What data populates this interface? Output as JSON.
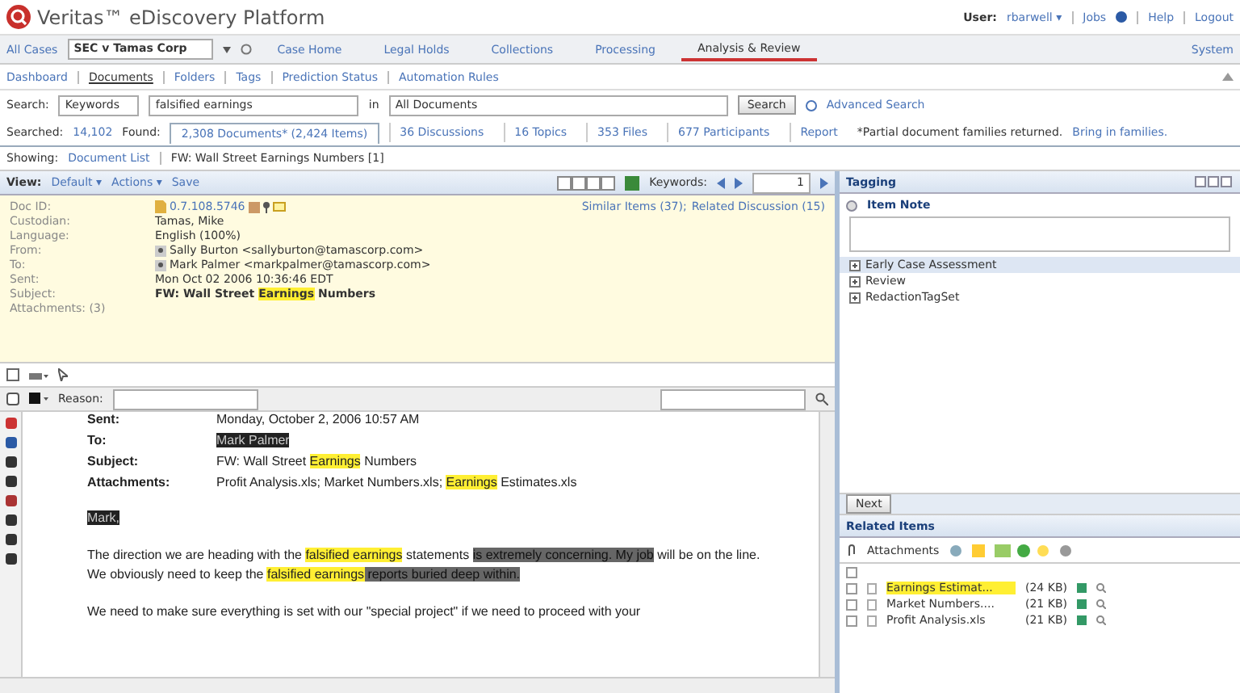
{
  "header": {
    "product": "Veritas™ eDiscovery Platform",
    "user_label": "User:",
    "user": "rbarwell ▾",
    "jobs": "Jobs",
    "help": "Help",
    "logout": "Logout"
  },
  "nav": {
    "all_cases": "All Cases",
    "case": "SEC v Tamas Corp",
    "tabs": [
      {
        "label": "Case Home",
        "selected": false
      },
      {
        "label": "Legal Holds",
        "selected": false
      },
      {
        "label": "Collections",
        "selected": false
      },
      {
        "label": "Processing",
        "selected": false
      },
      {
        "label": "Analysis & Review",
        "selected": true
      }
    ],
    "system": "System"
  },
  "subnav": [
    {
      "label": "Dashboard",
      "selected": false
    },
    {
      "label": "Documents",
      "selected": true
    },
    {
      "label": "Folders",
      "selected": false
    },
    {
      "label": "Tags",
      "selected": false
    },
    {
      "label": "Prediction Status",
      "selected": false
    },
    {
      "label": "Automation Rules",
      "selected": false
    }
  ],
  "search": {
    "label": "Search:",
    "type": "Keywords",
    "query": "falsified earnings",
    "in_label": "in",
    "scope": "All Documents",
    "button": "Search",
    "advanced": "Advanced Search"
  },
  "results": {
    "searched_label": "Searched:",
    "searched": "14,102",
    "found_label": "Found:",
    "tabs": [
      {
        "label": "2,308 Documents* (2,424 Items)",
        "selected": true
      },
      {
        "label": "36 Discussions",
        "selected": false
      },
      {
        "label": "16 Topics",
        "selected": false
      },
      {
        "label": "353 Files",
        "selected": false
      },
      {
        "label": "677 Participants",
        "selected": false
      },
      {
        "label": "Report",
        "selected": false
      }
    ],
    "note": "*Partial document families returned.",
    "note_link": "Bring in families."
  },
  "showing": {
    "label": "Showing:",
    "link": "Document List",
    "title": "FW: Wall Street Earnings Numbers [1]"
  },
  "viewer_toolbar": {
    "view_label": "View:",
    "view": "Default ▾",
    "actions": "Actions ▾",
    "save": "Save",
    "keywords": "Keywords:",
    "page": "1"
  },
  "metadata": {
    "fields": [
      {
        "label": "Doc ID:",
        "kind": "docid",
        "value": "0.7.108.5746"
      },
      {
        "label": "Custodian:",
        "kind": "plain",
        "value": "Tamas, Mike"
      },
      {
        "label": "Language:",
        "kind": "plain",
        "value": "English (100%)"
      },
      {
        "label": "From:",
        "kind": "person",
        "value": "Sally Burton <sallyburton@tamascorp.com>"
      },
      {
        "label": "To:",
        "kind": "person",
        "value": "Mark Palmer <markpalmer@tamascorp.com>"
      },
      {
        "label": "Sent:",
        "kind": "plain",
        "value": "Mon Oct 02 2006 10:36:46 EDT"
      },
      {
        "label": "Subject:",
        "kind": "subject",
        "segments": [
          {
            "text": "FW: Wall Street ",
            "hit": false
          },
          {
            "text": "Earnings",
            "hit": true
          },
          {
            "text": " Numbers",
            "hit": false
          }
        ]
      },
      {
        "label": "Attachments: (3)",
        "kind": "label"
      }
    ],
    "similar": "Similar Items (37);",
    "related": "Related Discussion (15)"
  },
  "redaction_toolbar": {
    "reason_label": "Reason:"
  },
  "document": {
    "header": [
      {
        "label": "Sent:",
        "segments": [
          {
            "text": "Monday, October 2, 2006 10:57 AM",
            "kind": "plain"
          }
        ]
      },
      {
        "label": "To:",
        "segments": [
          {
            "text": "Mark Palmer",
            "kind": "redacted"
          }
        ]
      },
      {
        "label": "Subject:",
        "segments": [
          {
            "text": "FW: Wall Street ",
            "kind": "plain"
          },
          {
            "text": "Earnings",
            "kind": "hit"
          },
          {
            "text": " Numbers",
            "kind": "plain"
          }
        ]
      },
      {
        "label": "Attachments:",
        "segments": [
          {
            "text": "Profit Analysis.xls; Market Numbers.xls; ",
            "kind": "plain"
          },
          {
            "text": "Earnings",
            "kind": "hit"
          },
          {
            "text": " Estimates.xls",
            "kind": "plain"
          }
        ]
      }
    ],
    "paragraphs": [
      [
        {
          "text": "Mark,",
          "kind": "redacted"
        }
      ],
      [
        {
          "text": "The direction we are heading with the ",
          "kind": "plain"
        },
        {
          "text": "falsified earnings",
          "kind": "hit"
        },
        {
          "text": " statements ",
          "kind": "plain"
        },
        {
          "text": "is extremely concerning. My job",
          "kind": "marked"
        },
        {
          "text": " will be on the line. We obviously need to keep the ",
          "kind": "plain"
        },
        {
          "text": "falsified earnings",
          "kind": "hit"
        },
        {
          "text": " reports buried deep within.",
          "kind": "marked"
        }
      ],
      [
        {
          "text": "We need to make sure everything is set with our \"special project\" if we need to proceed with your",
          "kind": "plain"
        }
      ]
    ]
  },
  "tagging": {
    "title": "Tagging",
    "item_note": "Item Note",
    "tags": [
      {
        "label": "Early Case Assessment",
        "selected": true
      },
      {
        "label": "Review",
        "selected": false
      },
      {
        "label": "RedactionTagSet",
        "selected": false
      }
    ],
    "next": "Next"
  },
  "related": {
    "title": "Related Items",
    "attachments": "Attachments",
    "select_all_checked": false,
    "items": [
      {
        "name": "Earnings Estimat...",
        "size": "(24 KB)",
        "hit": true,
        "checked": false
      },
      {
        "name": "Market Numbers....",
        "size": "(21 KB)",
        "hit": false,
        "checked": false
      },
      {
        "name": "Profit Analysis.xls",
        "size": "(21 KB)",
        "hit": false,
        "checked": false
      }
    ]
  }
}
